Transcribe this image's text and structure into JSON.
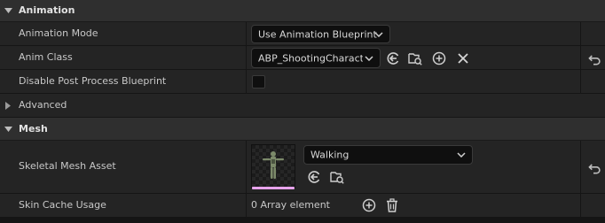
{
  "animation_section": {
    "title": "Animation",
    "animation_mode": {
      "label": "Animation Mode",
      "value": "Use Animation Blueprint"
    },
    "anim_class": {
      "label": "Anim Class",
      "value": "ABP_ShootingCharact·"
    },
    "disable_post_process": {
      "label": "Disable Post Process Blueprint",
      "checked": false
    },
    "advanced": {
      "label": "Advanced"
    }
  },
  "mesh_section": {
    "title": "Mesh",
    "skeletal_mesh_asset": {
      "label": "Skeletal Mesh Asset",
      "value": "Walking"
    },
    "skin_cache_usage": {
      "label": "Skin Cache Usage",
      "value": "0 Array element"
    }
  },
  "colors": {
    "thumbnail_underline": "#e7a3ec"
  },
  "icons": {
    "browse": "arrow-left-circle-icon",
    "find_in_browser": "folder-search-icon",
    "add": "plus-circle-icon",
    "clear": "x-icon",
    "reset": "reset-arrow-icon",
    "delete": "trash-icon"
  }
}
